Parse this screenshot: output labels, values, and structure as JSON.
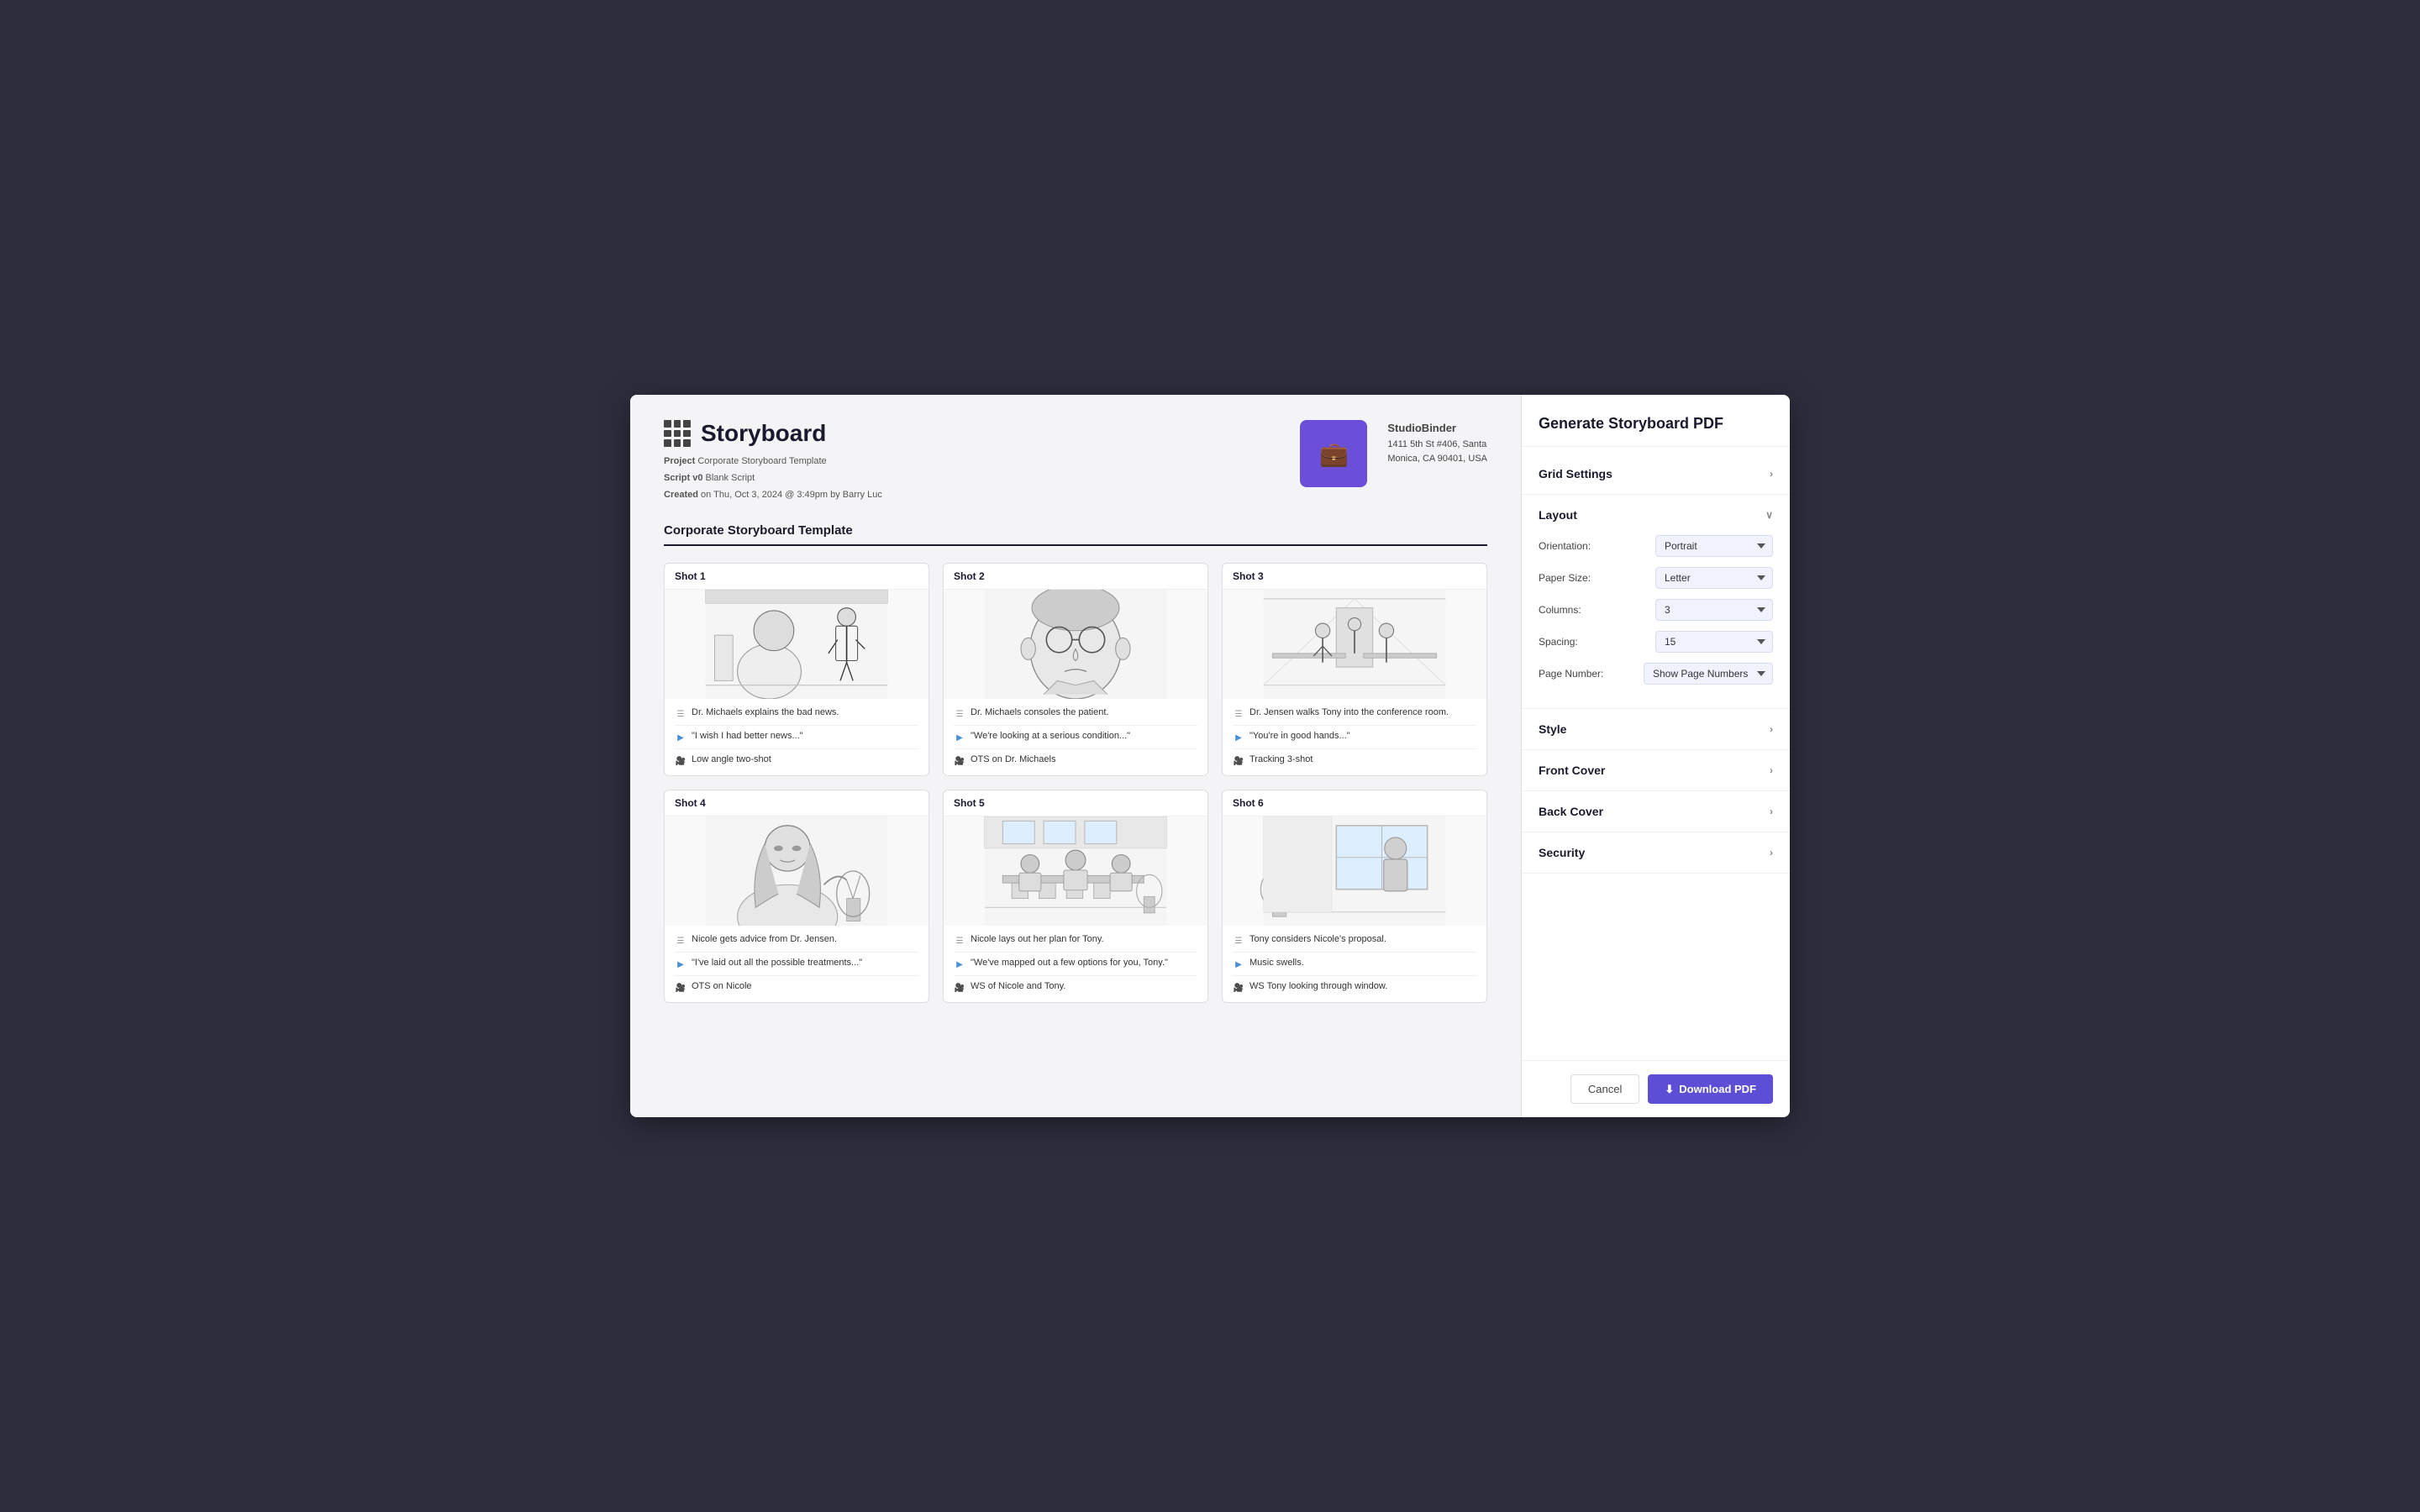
{
  "panel": {
    "title": "Generate Storyboard PDF",
    "sections": [
      {
        "id": "grid-settings",
        "label": "Grid Settings",
        "expanded": false
      },
      {
        "id": "layout",
        "label": "Layout",
        "expanded": true
      },
      {
        "id": "style",
        "label": "Style",
        "expanded": false
      },
      {
        "id": "front-cover",
        "label": "Front Cover",
        "expanded": false
      },
      {
        "id": "back-cover",
        "label": "Back Cover",
        "expanded": false
      },
      {
        "id": "security",
        "label": "Security",
        "expanded": false
      }
    ],
    "layout": {
      "orientation_label": "Orientation:",
      "orientation_value": "Portrait",
      "papersize_label": "Paper Size:",
      "papersize_value": "Letter",
      "columns_label": "Columns:",
      "columns_value": "3",
      "spacing_label": "Spacing:",
      "spacing_value": "15",
      "pagenumber_label": "Page Number:",
      "pagenumber_value": "Show Page Numbers"
    },
    "footer": {
      "cancel": "Cancel",
      "download": "Download PDF",
      "download_icon": "⬇"
    }
  },
  "storyboard": {
    "title": "Storyboard",
    "project_label": "Project",
    "project_value": "Corporate Storyboard Template",
    "script_label": "Script v0",
    "script_value": "Blank Script",
    "created_label": "Created",
    "created_value": "on Thu, Oct 3, 2024 @ 3:49pm by Barry Luc",
    "company": {
      "name": "StudioBinder",
      "address1": "1411 5th St #406, Santa",
      "address2": "Monica, CA 90401, USA"
    },
    "template_title": "Corporate Storyboard Template",
    "shots": [
      {
        "id": "shot-1",
        "label": "Shot  1",
        "description": "Dr. Michaels explains the bad news.",
        "audio": "\"I wish I had better news...\"",
        "camera": "Low angle two-shot"
      },
      {
        "id": "shot-2",
        "label": "Shot  2",
        "description": "Dr. Michaels consoles the patient.",
        "audio": "\"We're looking at a serious condition...\"",
        "camera": "OTS on Dr. Michaels"
      },
      {
        "id": "shot-3",
        "label": "Shot  3",
        "description": "Dr. Jensen walks Tony into the conference room.",
        "audio": "\"You're in good hands...\"",
        "camera": "Tracking 3-shot"
      },
      {
        "id": "shot-4",
        "label": "Shot  4",
        "description": "Nicole gets advice from Dr. Jensen.",
        "audio": "\"I've laid out all the possible treatments...\"",
        "camera": "OTS on Nicole"
      },
      {
        "id": "shot-5",
        "label": "Shot  5",
        "description": "Nicole lays out her plan for Tony.",
        "audio": "\"We've mapped out a few options for you, Tony.\"",
        "camera": "WS of Nicole and Tony."
      },
      {
        "id": "shot-6",
        "label": "Shot  6",
        "description": "Tony considers Nicole's proposal.",
        "audio": "Music swells.",
        "camera": "WS Tony looking through window."
      }
    ]
  }
}
